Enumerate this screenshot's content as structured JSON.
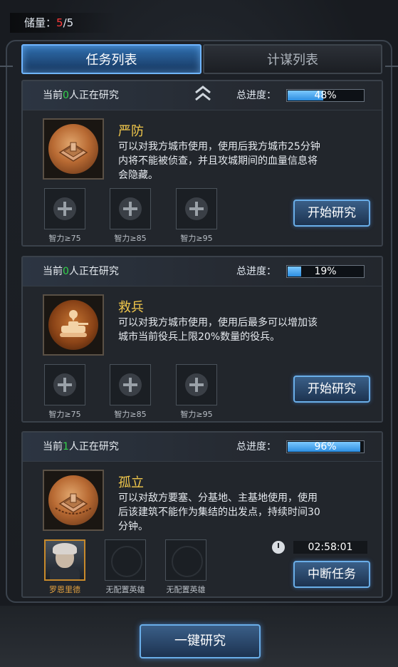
{
  "storage": {
    "label": "储量：",
    "current": "5",
    "sep_total": "/5"
  },
  "tabs": [
    {
      "label": "任务列表",
      "active": true
    },
    {
      "label": "计谋列表",
      "active": false
    }
  ],
  "cards": [
    {
      "status_prefix": "当前",
      "status_count": "0",
      "status_suffix": "人正在研究",
      "progress_label": "总进度：",
      "progress_text": "48%",
      "progress_value": 0.48,
      "title": "严防",
      "description": "可以对我方城市使用，使用后我方城市25分钟内将不能被侦查，并且攻城期间的血量信息将会隐藏。",
      "slots": [
        "智力≥75",
        "智力≥85",
        "智力≥95"
      ],
      "button": "开始研究"
    },
    {
      "status_prefix": "当前",
      "status_count": "0",
      "status_suffix": "人正在研究",
      "progress_label": "总进度：",
      "progress_text": "19%",
      "progress_value": 0.19,
      "title": "救兵",
      "description": "可以对我方城市使用，使用后最多可以增加该城市当前役兵上限20%数量的役兵。",
      "slots": [
        "智力≥75",
        "智力≥85",
        "智力≥95"
      ],
      "button": "开始研究"
    },
    {
      "status_prefix": "当前",
      "status_count": "1",
      "status_suffix": "人正在研究",
      "progress_label": "总进度：",
      "progress_text": "96%",
      "progress_value": 0.96,
      "title": "孤立",
      "description": "可以对敌方要塞、分基地、主基地使用，使用后该建筑不能作为集结的出发点，持续时间30分钟。",
      "heroes": [
        "罗恩里德",
        "无配置英雄",
        "无配置英雄"
      ],
      "timer": "02:58:01",
      "button": "中断任务"
    }
  ],
  "footer": {
    "button": "一键研究"
  },
  "colors": {
    "accent": "#6fb5ff",
    "title": "#f2c84b",
    "count_green": "#33d24a",
    "storage_red": "#ff3b3b"
  }
}
